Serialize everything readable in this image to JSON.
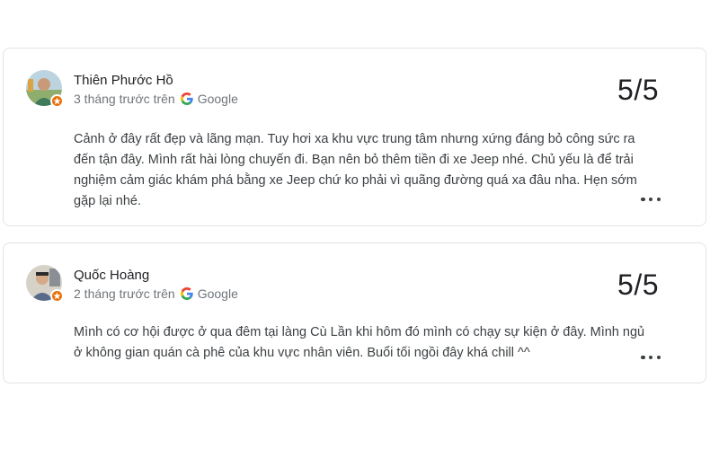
{
  "reviews": [
    {
      "name": "Thiên Phước Hồ",
      "time": "3 tháng trước trên",
      "source": "Google",
      "rating": "5/5",
      "text": "Cảnh ở đây rất đẹp và lãng mạn. Tuy hơi xa khu vực trung tâm nhưng xứng đáng bỏ công sức ra đến tận đây. Mình rất hài lòng chuyến đi. Bạn nên bỏ thêm tiền đi xe Jeep nhé. Chủ yếu là để trải nghiệm cảm giác khám phá bằng xe Jeep chứ ko phải vì quãng đường quá xa đâu nha. Hẹn sớm gặp lại nhé.",
      "icons": {
        "avatar": "avatar-photo",
        "badge": "local-guide-badge-icon",
        "source": "google-icon",
        "more": "more-options-icon"
      },
      "colors": {
        "badge": "#e8710a"
      }
    },
    {
      "name": "Quốc Hoàng",
      "time": "2 tháng trước trên",
      "source": "Google",
      "rating": "5/5",
      "text": "Mình có cơ hội được ở qua đêm tại làng Cù Lần khi hôm đó mình có chạy sự kiện ở đây. Mình ngủ ở không gian quán cà phê của khu vực nhân viên. Buổi tối ngồi đây khá chill ^^",
      "icons": {
        "avatar": "avatar-photo",
        "badge": "local-guide-badge-icon",
        "source": "google-icon",
        "more": "more-options-icon"
      },
      "colors": {
        "badge": "#e8710a"
      }
    }
  ]
}
